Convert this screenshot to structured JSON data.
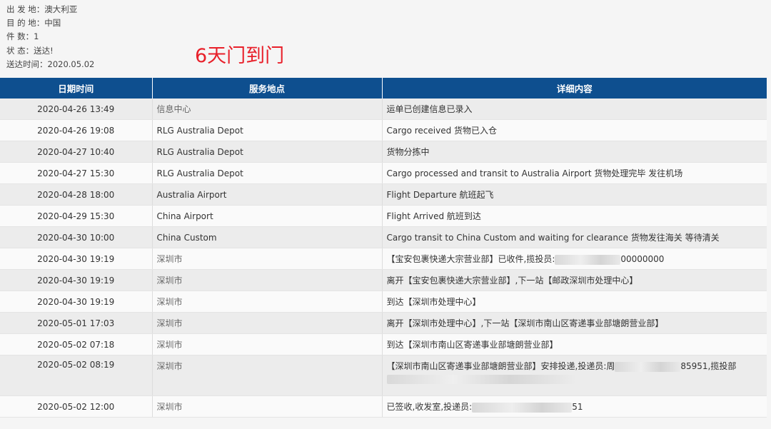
{
  "info": {
    "origin": "出 发 地：澳大利亚",
    "destination": "目 的 地：中国",
    "pieces": "件 数：1",
    "status": "状 态：送达!",
    "delivered_time": "送达时间：2020.05.02"
  },
  "headline": "6天门到门",
  "colors": {
    "header_bg": "#0e4f8f",
    "headline": "#e8202a"
  },
  "table": {
    "headers": [
      "日期时间",
      "服务地点",
      "详细内容"
    ],
    "rows": [
      {
        "datetime": "2020-04-26 13:49",
        "location": "信息中心",
        "detail": "运单已创建信息已录入"
      },
      {
        "datetime": "2020-04-26 19:08",
        "location": "RLG Australia Depot",
        "detail": "Cargo received 货物已入仓"
      },
      {
        "datetime": "2020-04-27 10:40",
        "location": "RLG Australia Depot",
        "detail": "货物分拣中"
      },
      {
        "datetime": "2020-04-27 15:30",
        "location": "RLG Australia Depot",
        "detail": "Cargo processed and transit to Australia Airport 货物处理完毕 发往机场"
      },
      {
        "datetime": "2020-04-28 18:00",
        "location": "Australia Airport",
        "detail": "Flight Departure 航班起飞"
      },
      {
        "datetime": "2020-04-29 15:30",
        "location": "China Airport",
        "detail": "Flight Arrived 航班到达"
      },
      {
        "datetime": "2020-04-30 10:00",
        "location": "China Custom",
        "detail": "Cargo transit to China Custom and waiting for clearance 货物发往海关 等待清关"
      },
      {
        "datetime": "2020-04-30 19:19",
        "location": "深圳市",
        "detail": "【宝安包裹快递大宗营业部】已收件,揽投员:",
        "detail_tail": "00000000"
      },
      {
        "datetime": "2020-04-30 19:19",
        "location": "深圳市",
        "detail": "离开【宝安包裹快递大宗营业部】,下一站【邮政深圳市处理中心】"
      },
      {
        "datetime": "2020-04-30 19:19",
        "location": "深圳市",
        "detail": "到达【深圳市处理中心】"
      },
      {
        "datetime": "2020-05-01 17:03",
        "location": "深圳市",
        "detail": "离开【深圳市处理中心】,下一站【深圳市南山区寄递事业部塘朗营业部】"
      },
      {
        "datetime": "2020-05-02 07:18",
        "location": "深圳市",
        "detail": "到达【深圳市南山区寄递事业部塘朗营业部】"
      },
      {
        "datetime": "2020-05-02 08:19",
        "location": "深圳市",
        "detail": "【深圳市南山区寄递事业部塘朗营业部】安排投递,投递员:周",
        "detail_tail": "85951,揽投部"
      },
      {
        "datetime": "2020-05-02 12:00",
        "location": "深圳市",
        "detail": "已签收,收发室,投递员:",
        "detail_tail": "51"
      }
    ]
  }
}
